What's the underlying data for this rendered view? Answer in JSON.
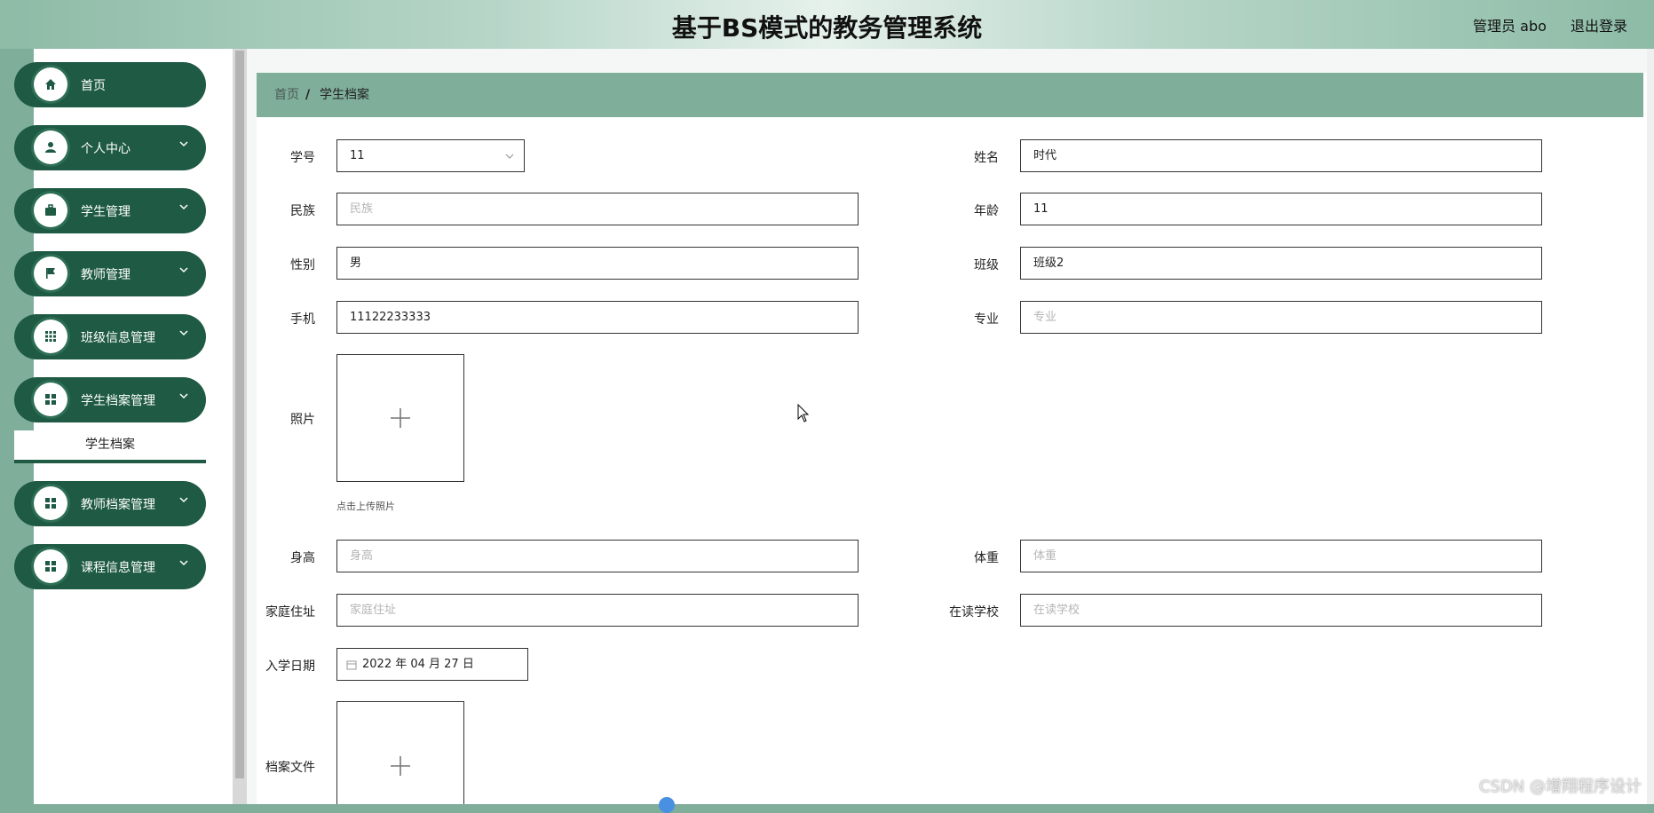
{
  "header": {
    "title": "基于BS模式的教务管理系统",
    "user": "管理员 abo",
    "logout": "退出登录"
  },
  "sidebar": {
    "items": [
      {
        "label": "首页",
        "icon": "home-icon"
      },
      {
        "label": "个人中心",
        "icon": "user-icon"
      },
      {
        "label": "学生管理",
        "icon": "briefcase-icon"
      },
      {
        "label": "教师管理",
        "icon": "flag-icon"
      },
      {
        "label": "班级信息管理",
        "icon": "grid-icon"
      },
      {
        "label": "学生档案管理",
        "icon": "apps-icon"
      },
      {
        "label": "教师档案管理",
        "icon": "apps-icon"
      },
      {
        "label": "课程信息管理",
        "icon": "apps-icon"
      }
    ],
    "submenu_active": "学生档案"
  },
  "breadcrumb": {
    "home": "首页",
    "separator": "/",
    "current": "学生档案"
  },
  "form": {
    "student_id": {
      "label": "学号",
      "value": "11"
    },
    "name": {
      "label": "姓名",
      "value": "时代"
    },
    "ethnicity": {
      "label": "民族",
      "placeholder": "民族"
    },
    "age": {
      "label": "年龄",
      "value": "11"
    },
    "gender": {
      "label": "性别",
      "value": "男"
    },
    "class": {
      "label": "班级",
      "value": "班级2"
    },
    "phone": {
      "label": "手机",
      "value": "11122233333"
    },
    "major": {
      "label": "专业",
      "placeholder": "专业"
    },
    "photo": {
      "label": "照片",
      "hint": "点击上传照片"
    },
    "height": {
      "label": "身高",
      "placeholder": "身高"
    },
    "weight": {
      "label": "体重",
      "placeholder": "体重"
    },
    "address": {
      "label": "家庭住址",
      "placeholder": "家庭住址"
    },
    "school": {
      "label": "在读学校",
      "placeholder": "在读学校"
    },
    "enroll_date": {
      "label": "入学日期",
      "value": "2022 年 04 月 27 日"
    },
    "archive_file": {
      "label": "档案文件"
    }
  },
  "watermark": "CSDN @增翔程序设计",
  "colors": {
    "sidebar_item": "#1e5a44",
    "accent": "#7fae9a"
  }
}
